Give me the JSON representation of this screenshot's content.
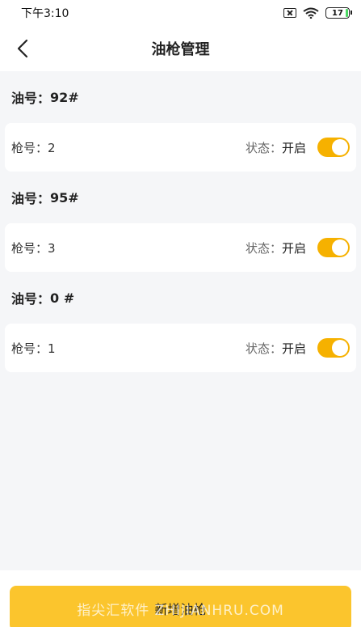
{
  "status_bar": {
    "time": "下午3:10",
    "battery": "17"
  },
  "nav": {
    "title": "油枪管理"
  },
  "groups": [
    {
      "fuel_label": "油号：",
      "fuel_value": "92#",
      "nozzle_label": "枪号：",
      "nozzle_value": "2",
      "status_label": "状态：",
      "status_value": "开启",
      "enabled": true
    },
    {
      "fuel_label": "油号：",
      "fuel_value": "95#",
      "nozzle_label": "枪号：",
      "nozzle_value": "3",
      "status_label": "状态：",
      "status_value": "开启",
      "enabled": true
    },
    {
      "fuel_label": "油号：",
      "fuel_value": "0 #",
      "nozzle_label": "枪号：",
      "nozzle_value": "1",
      "status_label": "状态：",
      "status_value": "开启",
      "enabled": true
    }
  ],
  "footer": {
    "add_button_label": "新增油枪",
    "watermark": "指尖汇软件 ZHIJIANHRU.COM"
  },
  "colors": {
    "accent": "#f6b100",
    "button": "#fbc52d",
    "background": "#f5f6f8"
  }
}
